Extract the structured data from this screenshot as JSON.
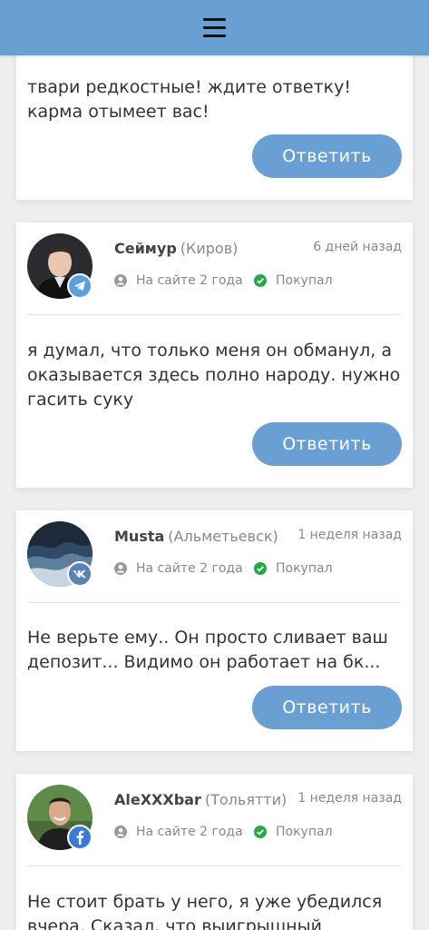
{
  "header": {
    "menu_icon": "hamburger-icon"
  },
  "reply_label": "Ответить",
  "colors": {
    "accent": "#6a9fd4",
    "check": "#22aa44",
    "telegram": "#5aa0dc",
    "vk": "#5a83b5",
    "facebook": "#3b7bd4"
  },
  "reviews": [
    {
      "text": "твари редкостные! ждите ответку! карма отымеет вас!"
    },
    {
      "name": "Сеймур",
      "city": "(Киров)",
      "date": "6 дней назад",
      "site_age": "На сайте 2 года",
      "status": "Покупал",
      "social": "telegram-icon",
      "text": "я думал, что только меня он обманул, а оказывается здесь полно народу. нужно гасить суку"
    },
    {
      "name": "Musta",
      "city": "(Альметьевск)",
      "date": "1 неделя назад",
      "site_age": "На сайте 2 года",
      "status": "Покупал",
      "social": "vk-icon",
      "text": "Не верьте ему.. Он просто сливает ваш депозит... Видимо он работает на бк..."
    },
    {
      "name": "AleXXXbar",
      "city": "(Тольятти)",
      "date": "1 неделя назад",
      "site_age": "На сайте 2 года",
      "status": "Покупал",
      "social": "facebook-icon",
      "text": "Не стоит брать у него, я уже убедился вчера. Сказал, что выигрышный вариант"
    }
  ]
}
